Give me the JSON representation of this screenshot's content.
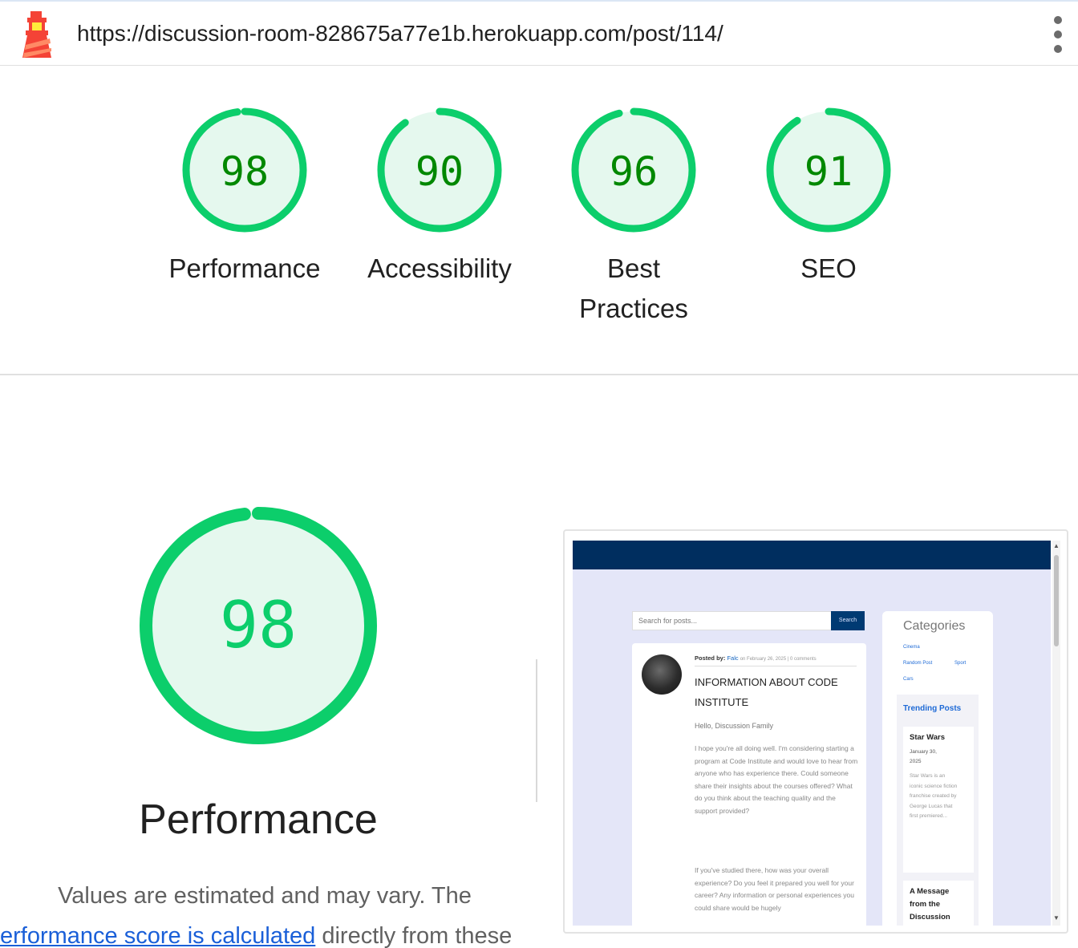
{
  "header": {
    "url": "https://discussion-room-828675a77e1b.herokuapp.com/post/114/",
    "logo_icon": "lighthouse-icon",
    "menu_icon": "more-vertical-icon"
  },
  "scores": [
    {
      "label": "Performance",
      "value": 98
    },
    {
      "label": "Accessibility",
      "value": 90
    },
    {
      "label": "Best Practices",
      "label_line1": "Best",
      "label_line2": "Practices",
      "value": 96
    },
    {
      "label": "SEO",
      "value": 91
    }
  ],
  "performance": {
    "score": 98,
    "title": "Performance",
    "desc_line1": "Values are estimated and may vary. The",
    "desc_link": "erformance score is calculated",
    "desc_line2_rest": " directly from these"
  },
  "colors": {
    "pass": "#0cce6b",
    "pass_text": "#008800",
    "pass_fill": "#e5f8ee"
  },
  "thumbnail": {
    "search_placeholder": "Search for posts...",
    "search_button": "Search",
    "posted_by_label": "Posted by:",
    "author": "Falc",
    "meta": "on February 26, 2025 | 0 comments",
    "post_title": "INFORMATION ABOUT CODE INSTITUTE",
    "greeting": "Hello, Discussion Family",
    "body": "I hope you're all doing well. I'm considering starting a program at Code Institute and would love to hear from anyone who has experience there. Could someone share their insights about the courses offered? What do you think about the teaching quality and the support provided?",
    "body2": "If you've studied there, how was your overall experience? Do you feel it prepared you well for your career? Any information or personal experiences you could share would be hugely",
    "categories_title": "Categories",
    "categories": [
      "Cinema",
      "Random Post",
      "Sport",
      "Cars"
    ],
    "trending_title": "Trending Posts",
    "trend1_title": "Star Wars",
    "trend1_date": "January 30, 2025",
    "trend1_body": "Star Wars is an iconic science fiction franchise created by George Lucas that first premiered...",
    "trend2_title": "A Message from the Discussion"
  }
}
